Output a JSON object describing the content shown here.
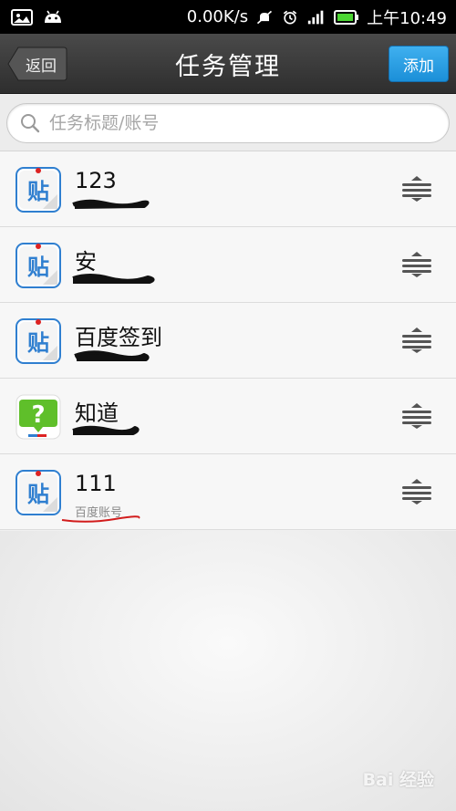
{
  "status_bar": {
    "net_speed": "0.00K/s",
    "time": "上午10:49",
    "icons": [
      "image-icon",
      "android-icon",
      "mute-icon",
      "alarm-icon",
      "signal-icon",
      "battery-icon"
    ]
  },
  "header": {
    "back_label": "返回",
    "title": "任务管理",
    "add_label": "添加"
  },
  "search": {
    "placeholder": "任务标题/账号"
  },
  "tasks": [
    {
      "title": "123",
      "subtitle": "",
      "icon": "tieba-icon"
    },
    {
      "title": "安",
      "subtitle": "",
      "icon": "tieba-icon"
    },
    {
      "title": "百度签到",
      "subtitle": "",
      "icon": "tieba-icon"
    },
    {
      "title": "知道",
      "subtitle": "",
      "icon": "zhidao-icon"
    },
    {
      "title": "111",
      "subtitle": "百度账号",
      "icon": "tieba-icon"
    }
  ],
  "watermark": "Bai 经验",
  "colors": {
    "accent": "#1b8fd8",
    "titlebar": "#3a3a3a",
    "tieba_blue": "#2f7fd0",
    "zhidao_green": "#5fbf2a",
    "annotation_red": "#d21c1c"
  }
}
